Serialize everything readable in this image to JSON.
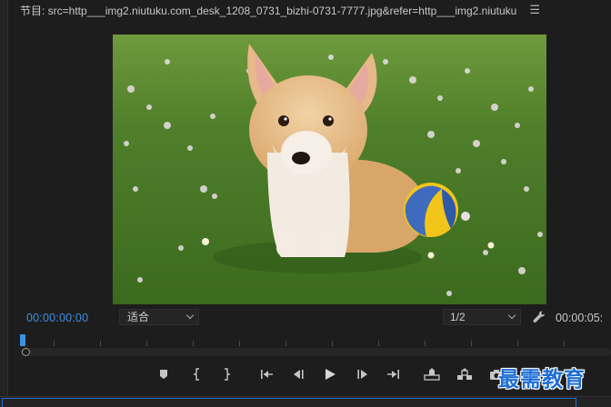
{
  "header": {
    "title": "节目: src=http___img2.niutuku.com_desk_1208_0731_bizhi-0731-7777.jpg&refer=http___img2.niutuku",
    "menu_icon": "hamburger-menu-icon"
  },
  "viewer": {
    "image_subject": "corgi-puppy-with-ball"
  },
  "controls": {
    "timecode_current": "00:00:00:00",
    "fit_value": "适合",
    "resolution_value": "1/2",
    "timecode_duration": "00:00:05:",
    "timecode_color": "#3f8fe2"
  },
  "transport": {
    "buttons": [
      "add-marker-icon",
      "mark-in-icon",
      "mark-out-icon",
      "go-to-in-icon",
      "step-back-icon",
      "play-icon",
      "step-forward-icon",
      "go-to-out-icon",
      "lift-icon",
      "extract-icon",
      "export-frame-icon"
    ]
  },
  "watermark": {
    "text": "最需教育"
  }
}
